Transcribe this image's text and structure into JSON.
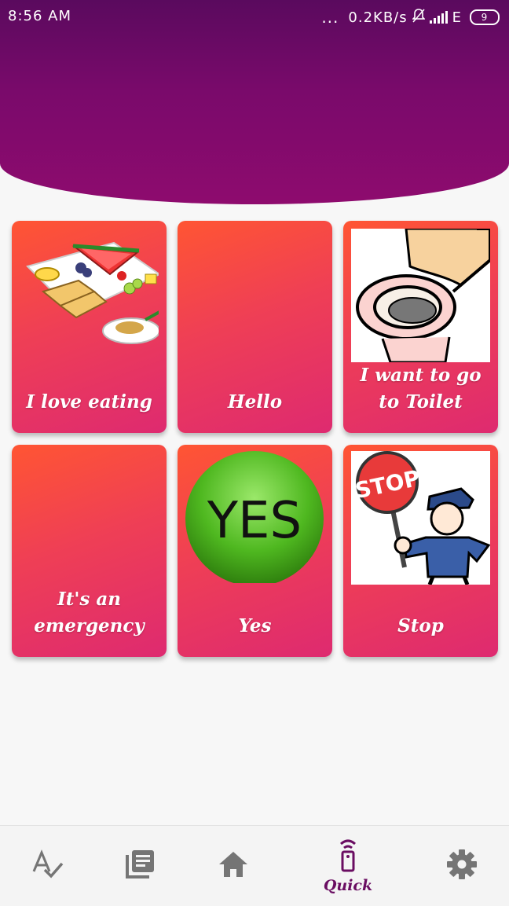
{
  "status_bar": {
    "time": "8:56 AM",
    "dots": "...",
    "network_speed": "0.2KB/s",
    "network_type": "E",
    "battery": "9"
  },
  "cards": [
    {
      "label": "I love eating",
      "image": "food-platter-image"
    },
    {
      "label": "Hello",
      "image": ""
    },
    {
      "label": "I want to go to Toilet",
      "image": "toilet-image"
    },
    {
      "label": "It's an emergency",
      "image": ""
    },
    {
      "label": "Yes",
      "image": "yes-button-image",
      "image_text": "YES"
    },
    {
      "label": "Stop",
      "image": "stop-policeman-image",
      "image_text": "STOP"
    }
  ],
  "nav": {
    "items": [
      {
        "icon": "spellcheck-icon",
        "label": ""
      },
      {
        "icon": "library-icon",
        "label": ""
      },
      {
        "icon": "home-icon",
        "label": ""
      },
      {
        "icon": "remote-icon",
        "label": "Quick",
        "active": true
      },
      {
        "icon": "gear-icon",
        "label": ""
      }
    ],
    "active_color": "#6a0d62",
    "inactive_color": "#757575"
  },
  "colors": {
    "header_top": "#5a0a5e",
    "header_bottom": "#8e0b6e",
    "card_top": "#ff5533",
    "card_bottom": "#de2a70"
  }
}
